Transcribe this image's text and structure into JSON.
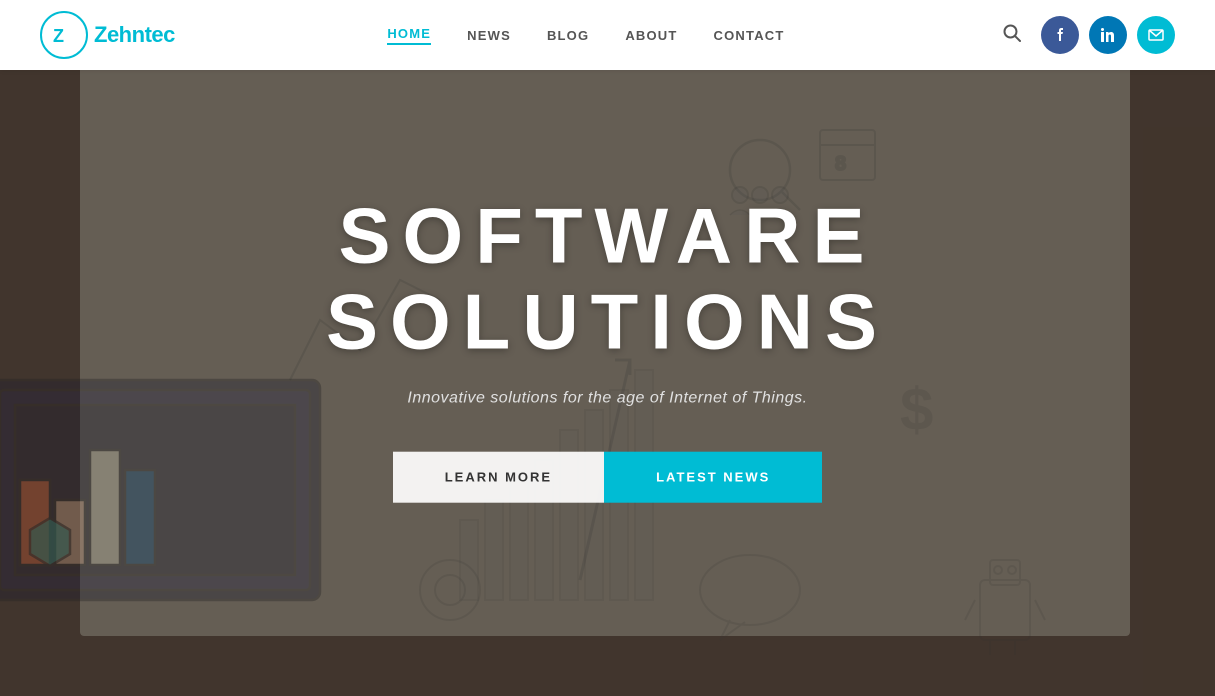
{
  "logo": {
    "circle_letter": "Z",
    "text_part1": "Zehn",
    "text_part2": "tec"
  },
  "nav": {
    "items": [
      {
        "label": "HOME",
        "active": true
      },
      {
        "label": "NEWS",
        "active": false
      },
      {
        "label": "BLOG",
        "active": false
      },
      {
        "label": "ABOUT",
        "active": false
      },
      {
        "label": "CONTACT",
        "active": false
      }
    ]
  },
  "social": {
    "facebook_icon": "f",
    "linkedin_icon": "in",
    "email_icon": "✉"
  },
  "hero": {
    "title": "SOFTWARE SOLUTIONS",
    "subtitle": "Innovative solutions for the age of Internet of Things.",
    "btn_learn": "LEARN MORE",
    "btn_news": "LATEST NEWS"
  },
  "colors": {
    "accent": "#00bcd4",
    "facebook": "#3b5998",
    "linkedin": "#0077b5"
  }
}
